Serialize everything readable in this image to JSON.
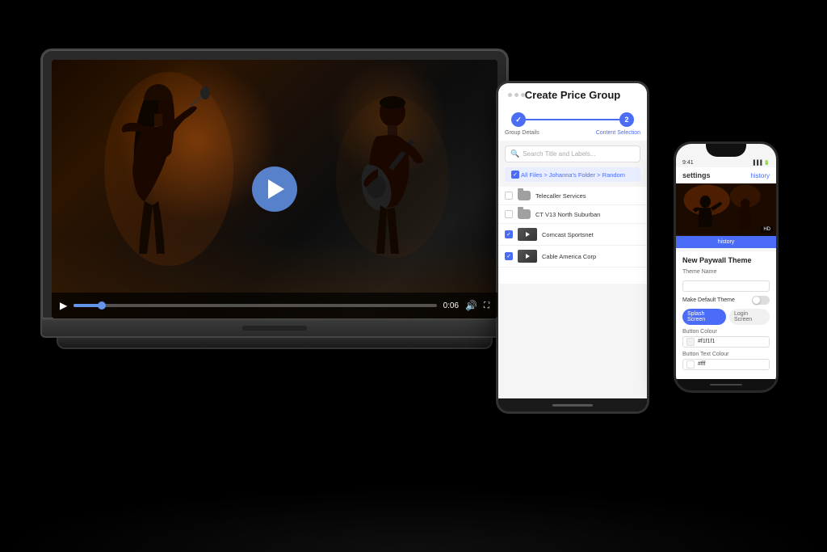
{
  "scene": {
    "background": "#000000"
  },
  "laptop": {
    "video": {
      "play_button_visible": true,
      "duration": "0:06",
      "progress_percent": 8
    }
  },
  "tablet": {
    "title": "Create Price Group",
    "steps": [
      {
        "label": "Group Details",
        "active": false,
        "number": "1"
      },
      {
        "label": "Content Selection",
        "active": true,
        "number": "2"
      }
    ],
    "search_placeholder": "Search Title and Labels...",
    "breadcrumb": "All Files > Johanna's Folder > Random",
    "files": [
      {
        "name": "Telecaller Services",
        "type": "folder",
        "checked": false
      },
      {
        "name": "CT V13 North Suburban",
        "type": "folder",
        "checked": false
      },
      {
        "name": "Comcast Sportsnet",
        "type": "video",
        "checked": true
      },
      {
        "name": "Cable America Corp",
        "type": "video",
        "checked": true
      }
    ]
  },
  "phone": {
    "status_time": "9:41",
    "header_title": "settings",
    "header_btn": "history",
    "section_title": "New Paywall Theme",
    "form_fields": [
      {
        "label": "Theme Name",
        "value": "",
        "placeholder": ""
      },
      {
        "label": "Make Default Theme",
        "type": "toggle"
      }
    ],
    "tabs": [
      {
        "label": "Splash Screen",
        "active": true
      },
      {
        "label": "Login Screen",
        "active": false
      }
    ],
    "color_fields": [
      {
        "label": "Button Colour",
        "value": "#f1f1f1",
        "color": "#f1f1f1"
      },
      {
        "label": "Button Text Colour",
        "value": "#fff",
        "color": "#ffffff"
      }
    ]
  }
}
